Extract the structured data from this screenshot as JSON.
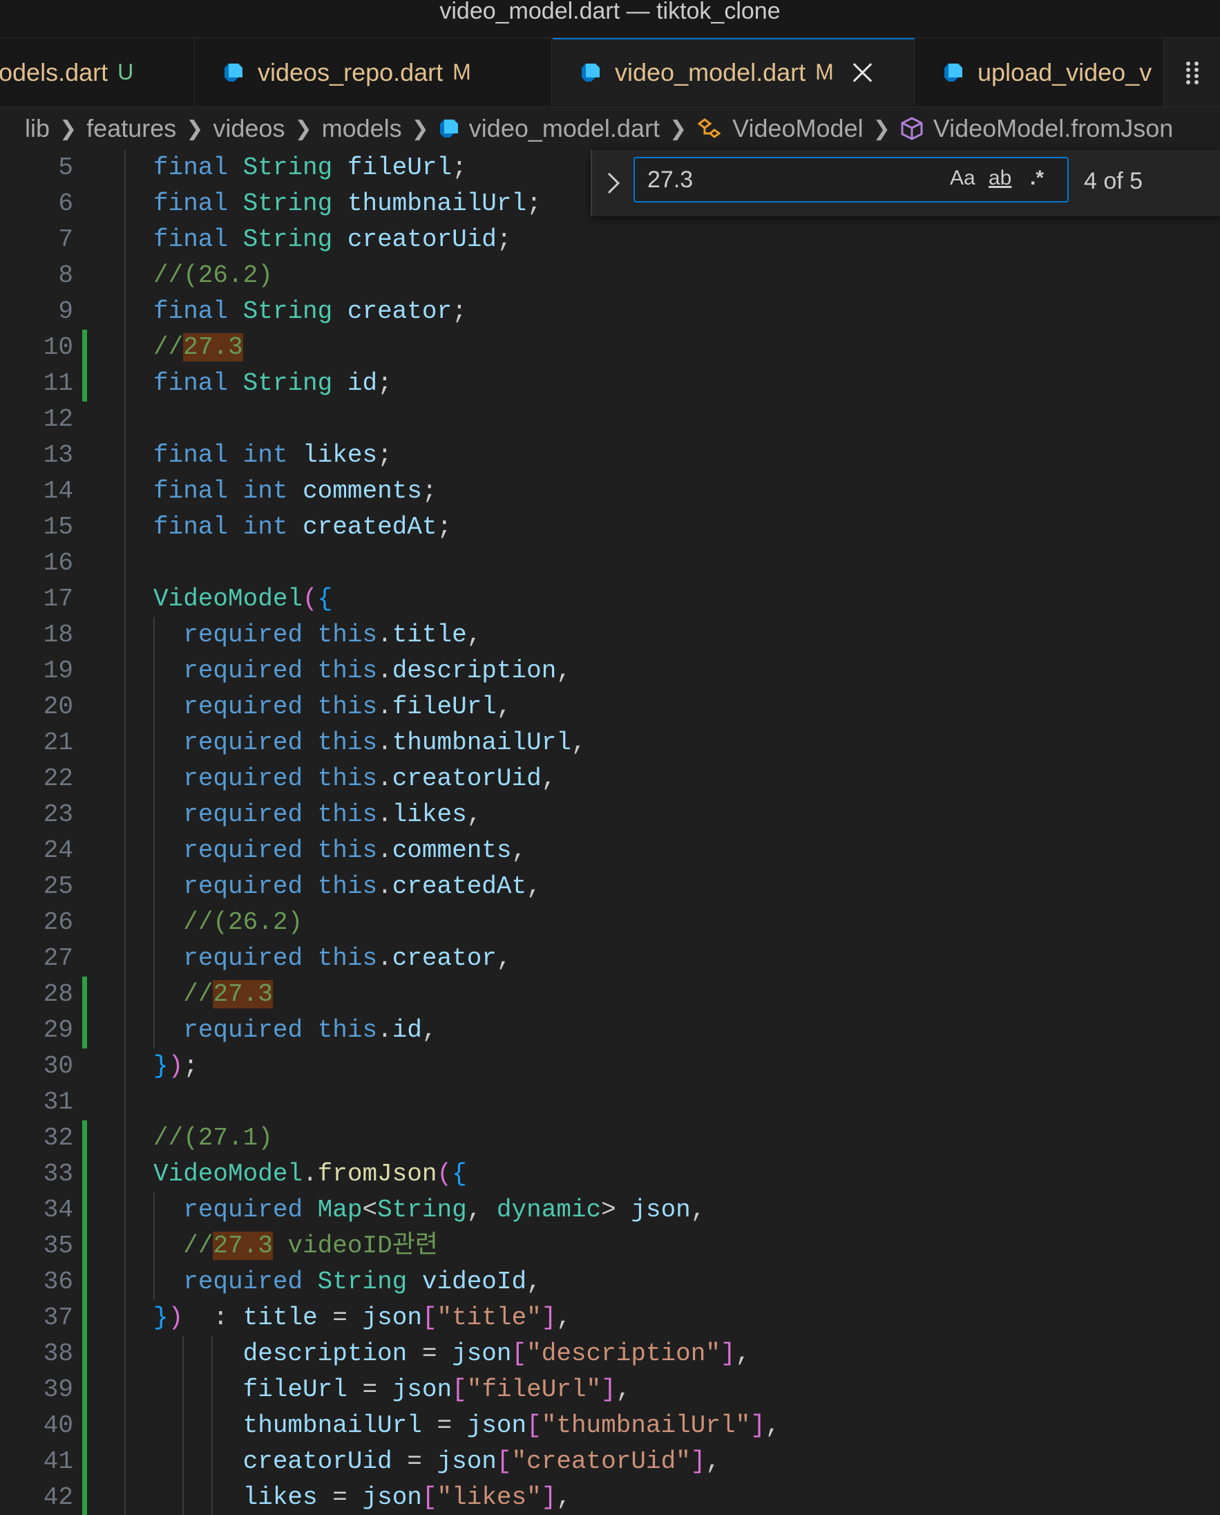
{
  "window": {
    "title": "video_model.dart — tiktok_clone"
  },
  "tabs": [
    {
      "name": "models.dart",
      "display": "odels.dart",
      "badge": "U",
      "active": false
    },
    {
      "name": "videos_repo.dart",
      "badge": "M",
      "active": false
    },
    {
      "name": "video_model.dart",
      "badge": "M",
      "active": true
    },
    {
      "name": "upload_video_view_model.dart",
      "display": "upload_video_v",
      "badge": "",
      "active": false
    }
  ],
  "breadcrumb": [
    "lib",
    "features",
    "videos",
    "models",
    "video_model.dart",
    "VideoModel",
    "VideoModel.fromJson"
  ],
  "find": {
    "query": "27.3",
    "case_label": "Aa",
    "word_label": "ab",
    "regex_label": ".*",
    "count": "4 of 5"
  },
  "editor": {
    "line_numbers": [
      "5",
      "6",
      "7",
      "8",
      "9",
      "10",
      "11",
      "12",
      "13",
      "14",
      "15",
      "16",
      "17",
      "18",
      "19",
      "20",
      "21",
      "22",
      "23",
      "24",
      "25",
      "26",
      "27",
      "28",
      "29",
      "30",
      "31",
      "32",
      "33",
      "34",
      "35",
      "36",
      "37",
      "38",
      "39",
      "40",
      "41",
      "42"
    ],
    "modified_lines": [
      "10",
      "11",
      "28",
      "29",
      "32",
      "33",
      "34",
      "35",
      "36",
      "37",
      "38",
      "39",
      "40",
      "41",
      "42"
    ],
    "lines": [
      "final String fileUrl;",
      "final String thumbnailUrl;",
      "final String creatorUid;",
      "//(26.2)",
      "final String creator;",
      "//27.3",
      "final String id;",
      "",
      "final int likes;",
      "final int comments;",
      "final int createdAt;",
      "",
      "VideoModel({",
      "  required this.title,",
      "  required this.description,",
      "  required this.fileUrl,",
      "  required this.thumbnailUrl,",
      "  required this.creatorUid,",
      "  required this.likes,",
      "  required this.comments,",
      "  required this.createdAt,",
      "  //(26.2)",
      "  required this.creator,",
      "  //27.3",
      "  required this.id,",
      "});",
      "",
      "//(27.1)",
      "VideoModel.fromJson({",
      "  required Map<String, dynamic> json,",
      "  //27.3 videoID관련",
      "  required String videoId,",
      "})  : title = json[\"title\"],",
      "      description = json[\"description\"],",
      "      fileUrl = json[\"fileUrl\"],",
      "      thumbnailUrl = json[\"thumbnailUrl\"],",
      "      creatorUid = json[\"creatorUid\"],",
      "      likes = json[\"likes\"],"
    ]
  },
  "colors": {
    "keyword": "#569cd6",
    "type": "#4ec9b0",
    "identifier": "#9cdcfe",
    "comment": "#6a9955",
    "string": "#ce9178",
    "match_highlight": "#613214",
    "gutter_modified": "#2ea043",
    "accent": "#0078d4"
  }
}
